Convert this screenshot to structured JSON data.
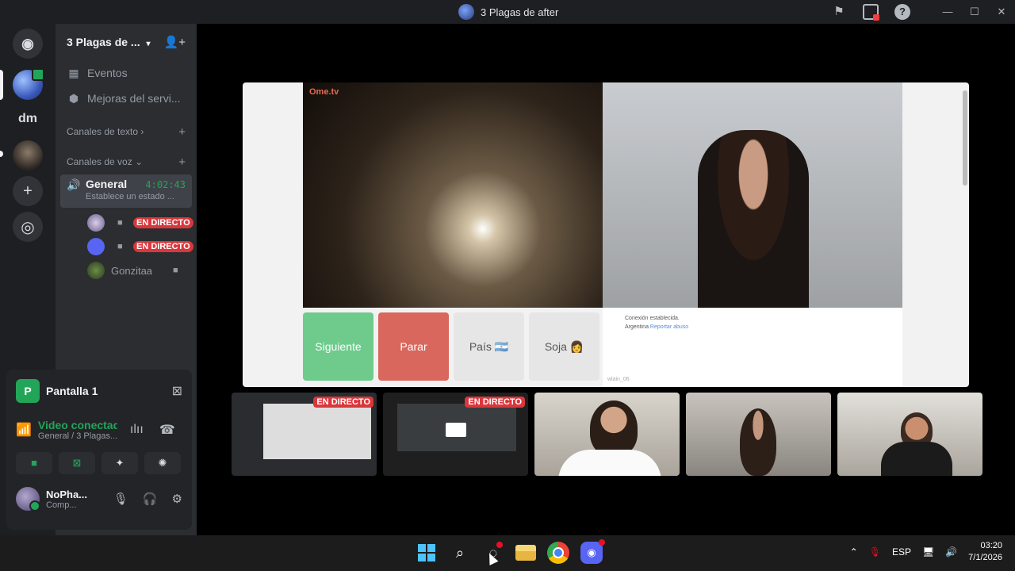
{
  "window": {
    "title": "3 Plagas de after"
  },
  "titlebar_icons": [
    "inbox-flag-icon",
    "screen-record-icon",
    "help-icon"
  ],
  "window_controls": [
    "minimize",
    "maximize",
    "close"
  ],
  "servers": [
    "discord-home",
    "3-plagas-server",
    "dm",
    "user-server",
    "add-server",
    "explore"
  ],
  "server_labels": {
    "dm": "dm"
  },
  "guild": {
    "name": "3 Plagas de ...",
    "chevron": "⌄"
  },
  "nav": {
    "events": "Eventos",
    "boosts": "Mejoras del servi..."
  },
  "categories": {
    "text": "Canales de texto",
    "voice": "Canales de voz"
  },
  "voice_channel": {
    "name": "General",
    "timer": "4:02:43",
    "status": "Establece un estado ..."
  },
  "voice_users": [
    {
      "name": "",
      "live": "EN DIRECTO"
    },
    {
      "name": "",
      "live": "EN DIRECTO"
    },
    {
      "name": "Gonzitaa",
      "live": ""
    }
  ],
  "panel": {
    "share_label": "Pantalla 1",
    "conn_title": "Video conectad",
    "conn_sub": "General / 3 Plagas...",
    "user_name": "NoPha...",
    "user_status": "Comp..."
  },
  "omegle": {
    "logo": "Ome.tv",
    "buttons": {
      "next": "Siguiente",
      "stop": "Parar",
      "country": "País 🇦🇷",
      "gender": "Soja 👩"
    },
    "chat_line1": "Conexión establecida.",
    "chat_country": "Argentina",
    "chat_report": "Reportar abuso",
    "chat_footer": "wlain_06"
  },
  "tiles": {
    "live_label_1": "EN DIRECTO",
    "live_label_2": "EN DIRECTO"
  },
  "taskbar": {
    "lang": "ESP",
    "time": "03:20",
    "date": "7/1/2026"
  }
}
